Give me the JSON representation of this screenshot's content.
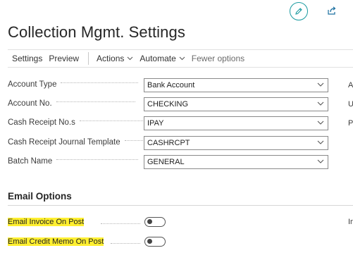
{
  "header": {
    "edit_icon": "pencil-icon",
    "share_icon": "share-icon",
    "title": "Collection Mgmt. Settings"
  },
  "action_bar": {
    "items": [
      {
        "label": "Settings"
      },
      {
        "label": "Preview"
      },
      {
        "label": "Actions",
        "has_dropdown": true
      },
      {
        "label": "Automate",
        "has_dropdown": true
      },
      {
        "label": "Fewer options"
      }
    ]
  },
  "fields": [
    {
      "label": "Account Type",
      "value": "Bank Account"
    },
    {
      "label": "Account No.",
      "value": "CHECKING"
    },
    {
      "label": "Cash Receipt No.s",
      "value": "IPAY"
    },
    {
      "label": "Cash Receipt Journal Template",
      "value": "CASHRCPT"
    },
    {
      "label": "Batch Name",
      "value": "GENERAL"
    }
  ],
  "right_column_clipped": [
    "A",
    "U",
    "P",
    "In"
  ],
  "email_options": {
    "section_title": "Email Options",
    "toggles": [
      {
        "label": "Email Invoice On Post",
        "on": false,
        "highlighted": true
      },
      {
        "label": "Email Credit Memo On Post",
        "on": false,
        "highlighted": true
      }
    ]
  },
  "colors": {
    "accent": "#1a9aa0",
    "highlight": "#ffef30"
  }
}
